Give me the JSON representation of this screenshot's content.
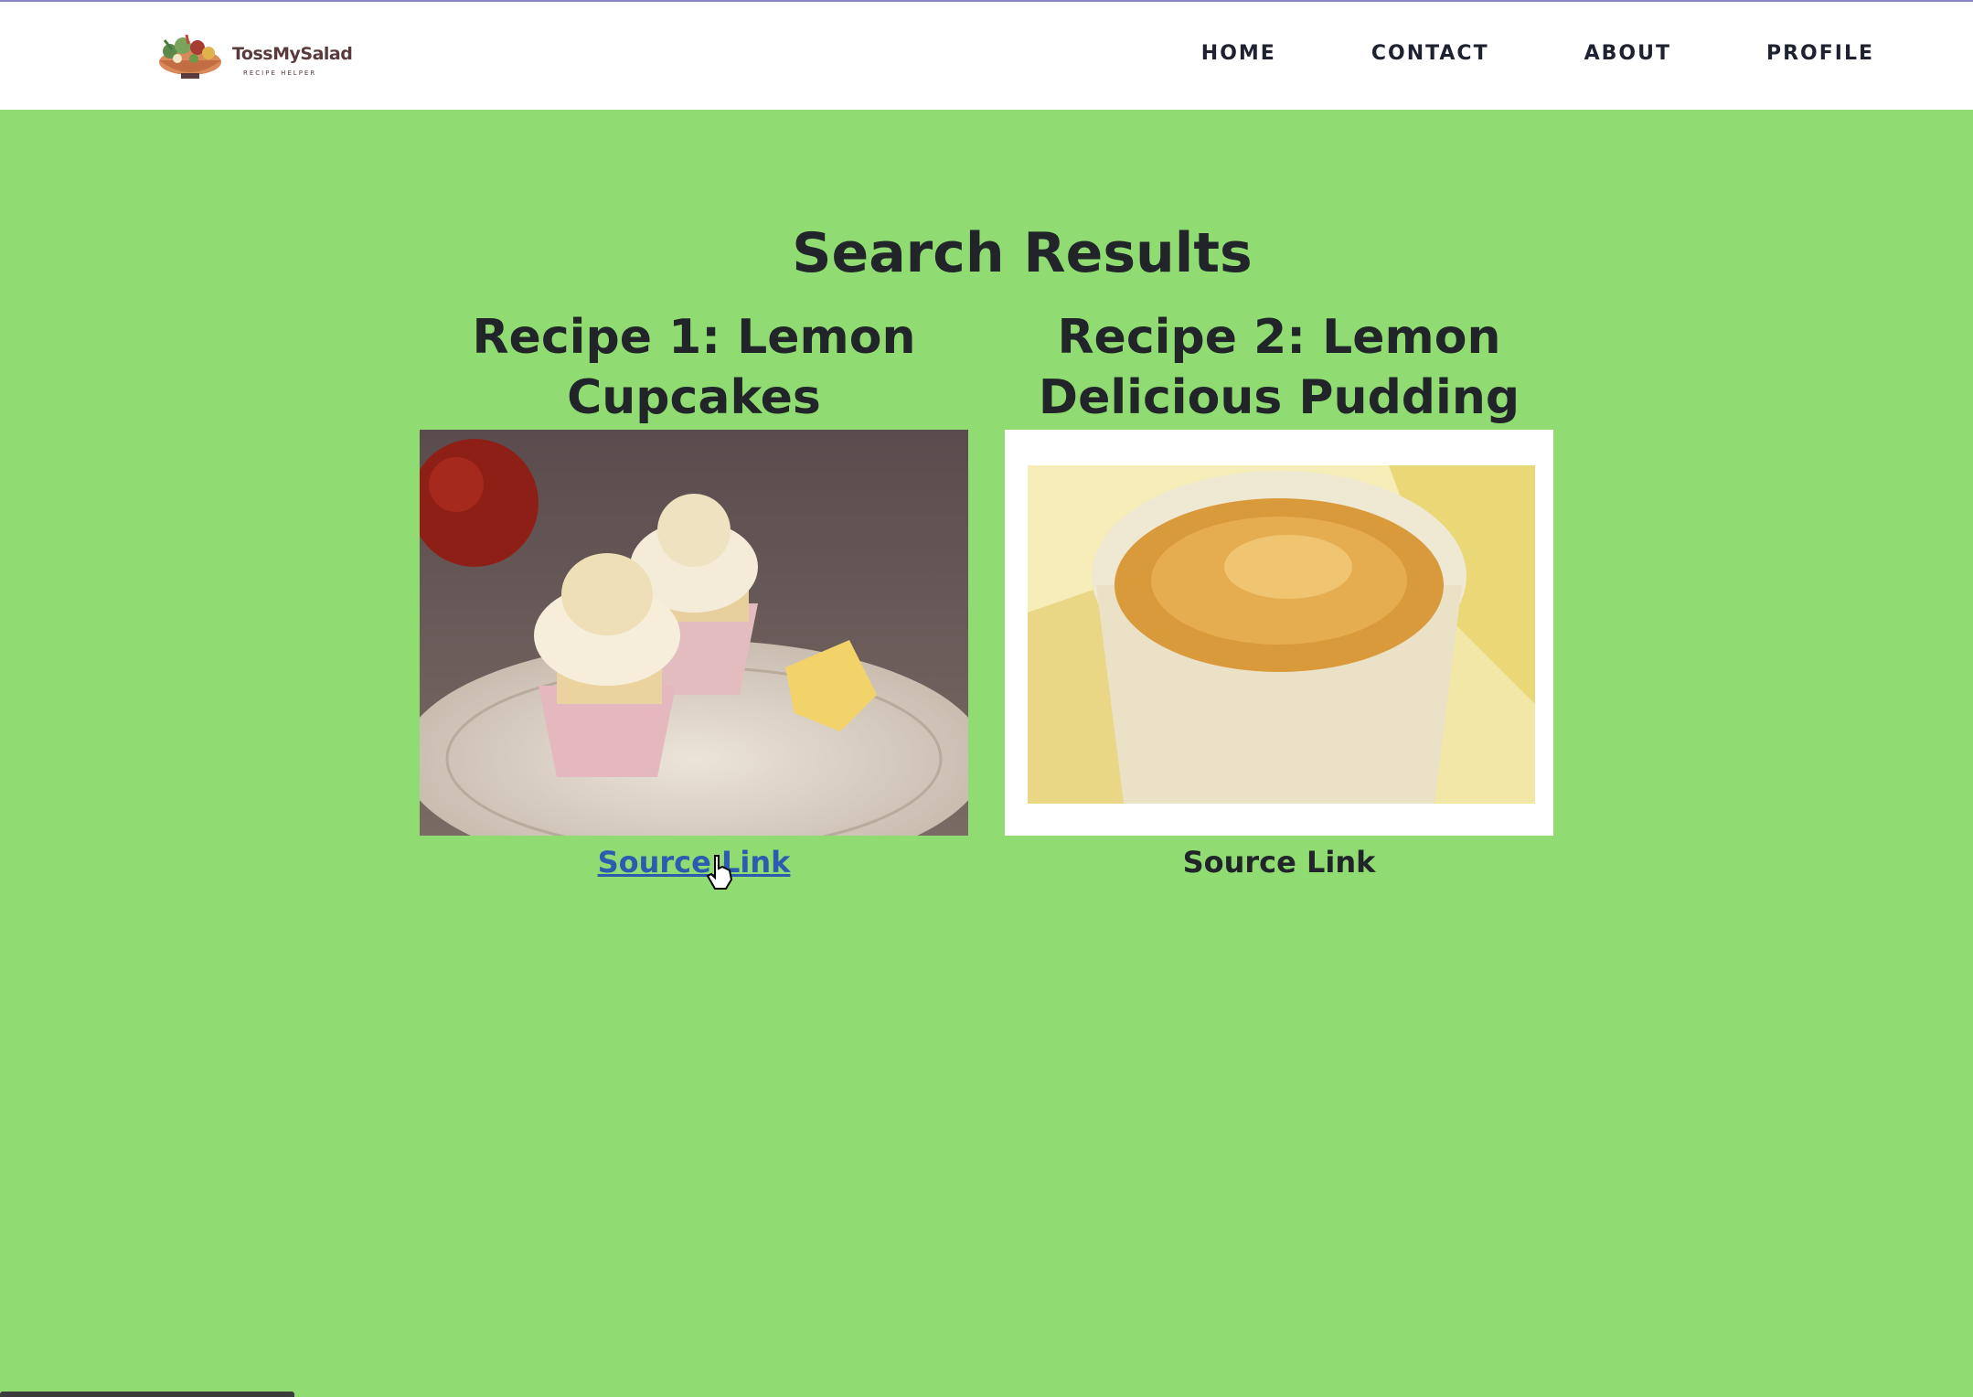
{
  "header": {
    "logo_text": "TossMySalad",
    "logo_subtitle": "RECIPE HELPER",
    "nav": [
      {
        "label": "HOME"
      },
      {
        "label": "CONTACT"
      },
      {
        "label": "ABOUT"
      },
      {
        "label": "PROFILE"
      }
    ]
  },
  "main": {
    "title": "Search Results",
    "recipes": [
      {
        "title": "Recipe 1: Lemon Cupcakes",
        "image_alt": "lemon-cupcakes-photo",
        "link_label": "Source Link"
      },
      {
        "title": "Recipe 2: Lemon Delicious Pudding",
        "image_alt": "lemon-pudding-photo",
        "link_label": "Source Link"
      }
    ]
  },
  "colors": {
    "page_background": "#90dc72",
    "header_background": "#ffffff",
    "text": "#212529",
    "link_hover": "#2a5db0"
  }
}
